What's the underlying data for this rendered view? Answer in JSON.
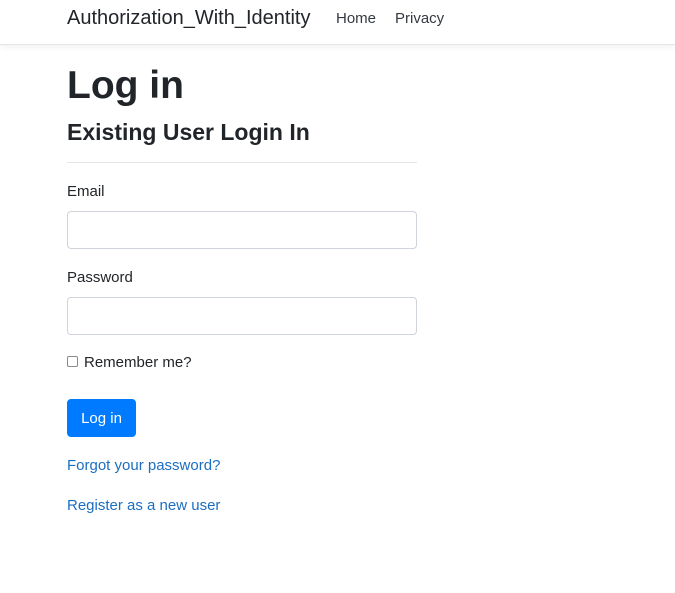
{
  "navbar": {
    "brand": "Authorization_With_Identity",
    "links": [
      {
        "label": "Home"
      },
      {
        "label": "Privacy"
      }
    ]
  },
  "page": {
    "title": "Log in",
    "section_title": "Existing User Login In"
  },
  "form": {
    "email_label": "Email",
    "email_value": "",
    "password_label": "Password",
    "password_value": "",
    "remember_label": "Remember me?",
    "remember_checked": false,
    "submit_label": "Log in"
  },
  "links": {
    "forgot_password": "Forgot your password?",
    "register": "Register as a new user"
  },
  "colors": {
    "primary": "#007bff",
    "link": "#1b6ec2"
  }
}
